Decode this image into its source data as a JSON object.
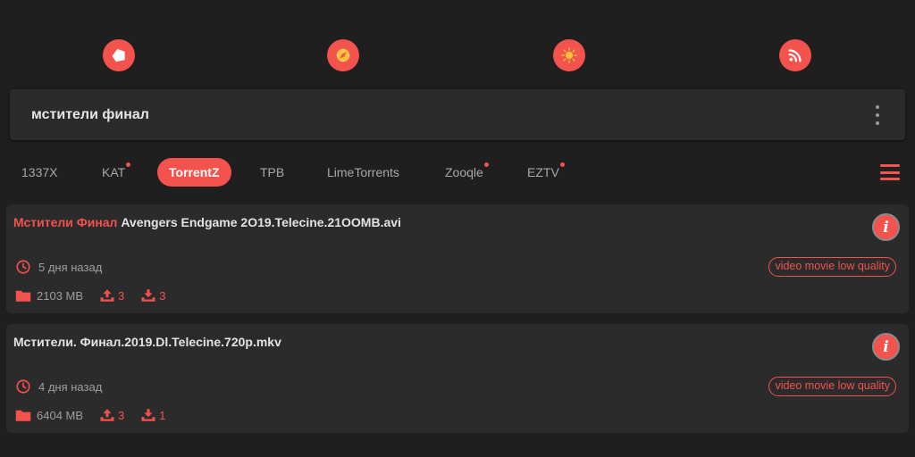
{
  "top_icons": [
    {
      "name": "home-icon",
      "left": 0
    },
    {
      "name": "compass-icon",
      "left": 0
    },
    {
      "name": "sun-icon",
      "left": 0
    },
    {
      "name": "rss-icon",
      "left": 0
    }
  ],
  "search": {
    "value": "мстители финал"
  },
  "tabs": [
    {
      "label": "1337X",
      "dot": false
    },
    {
      "label": "KAT",
      "dot": true
    },
    {
      "label": "TorrentZ",
      "dot": false,
      "active": true
    },
    {
      "label": "TPB",
      "dot": false
    },
    {
      "label": "LimeTorrents",
      "dot": false
    },
    {
      "label": "Zooqle",
      "dot": true
    },
    {
      "label": "EZTV",
      "dot": true
    }
  ],
  "results": [
    {
      "title_highlight": "Мстители Финал",
      "title_rest": " Avengers Endgame 2O19.Telecine.21OOMB.avi",
      "date": "5 дня назад",
      "quality": "video movie low quality",
      "size": "2103 MB",
      "seeders": "3",
      "leechers": "3"
    },
    {
      "title_highlight": "",
      "title_rest": "Мстители. Финал.2019.Dl.Telecine.720p.mkv",
      "date": "4 дня назад",
      "quality": "video movie low quality",
      "size": "6404 MB",
      "seeders": "3",
      "leechers": "1"
    }
  ],
  "colors": {
    "accent": "#f4524d",
    "background": "#1f1f1f",
    "card": "#2b2b2b"
  }
}
